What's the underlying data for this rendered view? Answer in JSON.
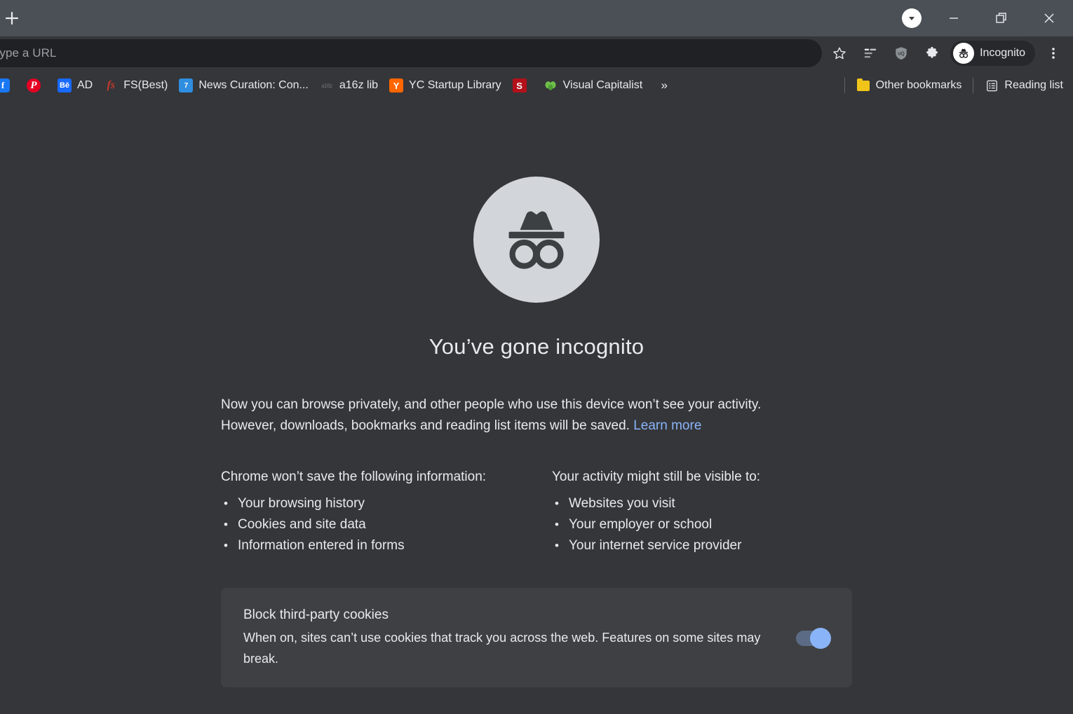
{
  "window": {
    "new_tab_label": "New tab",
    "tab_search_label": "Search tabs",
    "minimize_label": "Minimize",
    "maximize_label": "Maximize",
    "close_label": "Close"
  },
  "omnibox": {
    "placeholder": "Search Google or type a URL",
    "visible_text": "e or type a URL",
    "bookmark_star_label": "Bookmark this tab"
  },
  "toolbar": {
    "reading_list_label": "Reading list",
    "ublock_label": "uBlock Origin",
    "extensions_label": "Extensions",
    "profile_label": "Incognito",
    "menu_label": "Customize and control Google Chrome"
  },
  "bookmarks": {
    "items": [
      {
        "label": "",
        "icon": "facebook-icon",
        "glyph": "f"
      },
      {
        "label": "",
        "icon": "pinterest-icon",
        "glyph": "P"
      },
      {
        "label": "AD",
        "icon": "behance-icon",
        "glyph": "Bē"
      },
      {
        "label": "FS(Best)",
        "icon": "fs-icon",
        "glyph": "fs"
      },
      {
        "label": "News Curation: Con...",
        "icon": "calendar-icon",
        "glyph": "7"
      },
      {
        "label": "a16z lib",
        "icon": "a16z-icon",
        "glyph": "a16z"
      },
      {
        "label": "YC Startup Library",
        "icon": "ycombinator-icon",
        "glyph": "Y"
      },
      {
        "label": "",
        "icon": "scribd-icon",
        "glyph": "S"
      },
      {
        "label": "Visual Capitalist",
        "icon": "visual-capitalist-icon",
        "glyph": ""
      }
    ],
    "overflow_label": "»",
    "other_bookmarks_label": "Other bookmarks",
    "reading_list_label": "Reading list"
  },
  "page": {
    "title": "You’ve gone incognito",
    "intro_line1": "Now you can browse privately, and other people who use this device won’t see your activity.",
    "intro_line2": "However, downloads, bookmarks and reading list items will be saved. ",
    "learn_more": "Learn more",
    "columns": [
      {
        "heading": "Chrome won’t save the following information:",
        "items": [
          "Your browsing history",
          "Cookies and site data",
          "Information entered in forms"
        ]
      },
      {
        "heading": "Your activity might still be visible to:",
        "items": [
          "Websites you visit",
          "Your employer or school",
          "Your internet service provider"
        ]
      }
    ],
    "cookie_card": {
      "heading": "Block third-party cookies",
      "description": "When on, sites can’t use cookies that track you across the web. Features on some sites may break.",
      "toggle_state": "on"
    }
  },
  "colors": {
    "tabstrip_bg": "#4b5056",
    "page_bg": "#35363a",
    "omnibox_bg": "#202124",
    "card_bg": "#3f4043",
    "link": "#8ab4f8",
    "toggle_knob": "#8ab4f8",
    "text": "#e8eaed"
  }
}
